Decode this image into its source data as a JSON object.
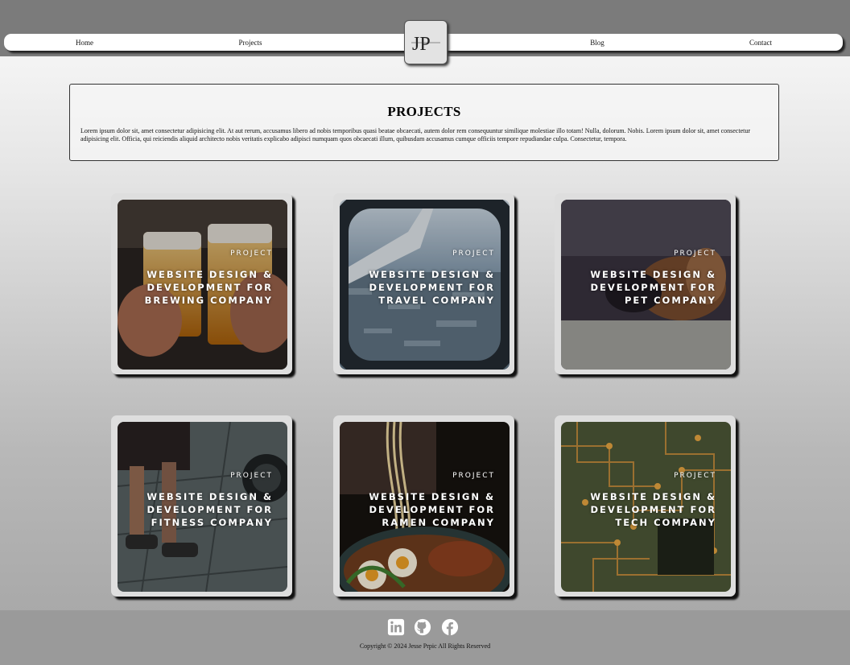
{
  "nav": {
    "items": [
      {
        "label": "Home"
      },
      {
        "label": "Projects"
      },
      {
        "label": "Blog"
      },
      {
        "label": "Contact"
      }
    ],
    "logo_text": "JP"
  },
  "intro": {
    "title": "PROJECTS",
    "body": "Lorem ipsum dolor sit, amet consectetur adipisicing elit. At aut rerum, accusamus libero ad nobis temporibus quasi beatae obcaecati, autem dolor rem consequuntur similique molestiae illo totam! Nulla, dolorum. Nobis. Lorem ipsum dolor sit, amet consectetur adipisicing elit. Officia, qui reiciendis aliquid architecto nobis veritatis explicabo adipisci numquam quos obcaecati illum, quibusdam accusamus cumque officiis tempore repudiandae culpa. Consectetur, tempora."
  },
  "projects": [
    {
      "kicker": "PROJECT",
      "title": "WEBSITE DESIGN & DEVELOPMENT FOR BREWING COMPANY"
    },
    {
      "kicker": "PROJECT",
      "title": "WEBSITE DESIGN & DEVELOPMENT FOR TRAVEL COMPANY"
    },
    {
      "kicker": "PROJECT",
      "title": "WEBSITE DESIGN & DEVELOPMENT FOR PET COMPANY"
    },
    {
      "kicker": "PROJECT",
      "title": "WEBSITE DESIGN & DEVELOPMENT FOR FITNESS COMPANY"
    },
    {
      "kicker": "PROJECT",
      "title": "WEBSITE DESIGN & DEVELOPMENT FOR RAMEN COMPANY"
    },
    {
      "kicker": "PROJECT",
      "title": "WEBSITE DESIGN & DEVELOPMENT FOR TECH COMPANY"
    }
  ],
  "footer": {
    "icons": [
      "linkedin-icon",
      "github-icon",
      "facebook-icon"
    ],
    "copyright": "Copyright © 2024 Jesse Prpic All Rights Reserved"
  }
}
